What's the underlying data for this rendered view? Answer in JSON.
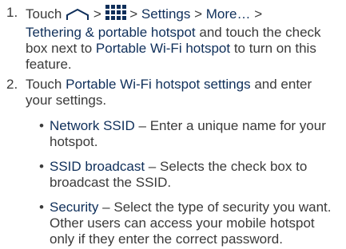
{
  "steps": [
    {
      "num": "1.",
      "touch": "Touch",
      "sep1": ">",
      "sep2": ">",
      "settings": "Settings",
      "sep3": ">",
      "more": "More…",
      "sep4": ">",
      "tethering": "Tethering & portable hotspot",
      "mid": "and touch the check box next to",
      "portable": "Portable Wi-Fi hotspot",
      "tail": "to turn on this feature.",
      "icons": [
        "home-icon",
        "apps-grid-icon"
      ]
    },
    {
      "num": "2.",
      "touch": "Touch",
      "settings_link": "Portable Wi-Fi hotspot settings",
      "tail": "and enter your settings."
    }
  ],
  "bullets": [
    {
      "term": "Network SSID",
      "dash": "–",
      "desc": "Enter a unique name for your hotspot."
    },
    {
      "term": "SSID broadcast",
      "dash": "–",
      "desc": "Selects the check box to broadcast the SSID."
    },
    {
      "term": "Security",
      "dash": "–",
      "desc": "Select the type of security you want. Other users can access your mobile hotspot only if they enter the correct password."
    }
  ],
  "bullet_char": "•",
  "colors": {
    "text": "#3a3a3a",
    "emphasis": "#0f2f5a"
  }
}
